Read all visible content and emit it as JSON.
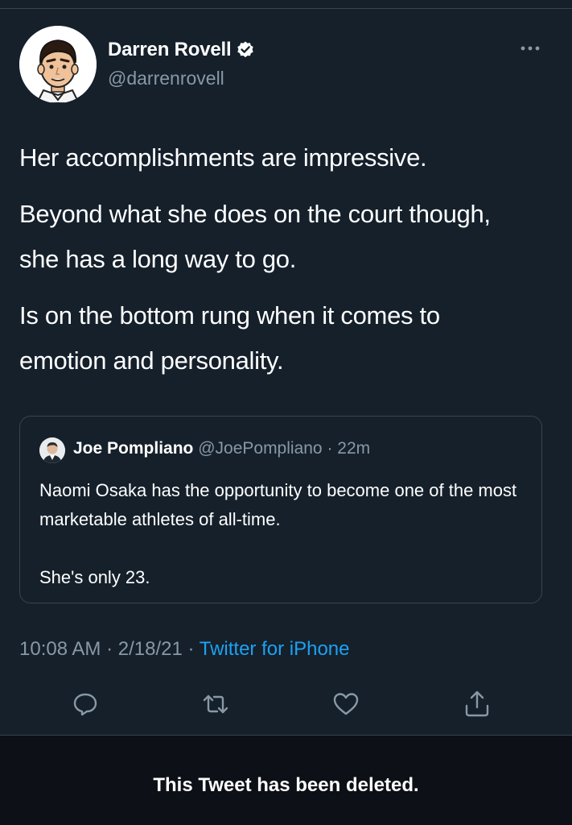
{
  "author": {
    "display_name": "Darren Rovell",
    "handle": "@darrenrovell",
    "verified": true,
    "avatar_icon": "cartoon-man-avatar-icon"
  },
  "tweet": {
    "paragraphs": [
      "Her accomplishments are impressive.",
      "Beyond what she does on the court though, she has a long way to go.",
      "Is on the bottom rung when it comes to emotion and personality."
    ]
  },
  "quoted_tweet": {
    "display_name": "Joe Pompliano",
    "handle": "@JoePompliano",
    "separator": "·",
    "time": "22m",
    "body_line1": "Naomi Osaka has the opportunity to become one of the most marketable athletes of all-time.",
    "body_line2": "She's only 23."
  },
  "meta": {
    "time": "10:08 AM",
    "separator1": "·",
    "date": "2/18/21",
    "separator2": "·",
    "source": "Twitter for iPhone"
  },
  "actions": {
    "reply_icon": "reply-icon",
    "retweet_icon": "retweet-icon",
    "like_icon": "heart-icon",
    "share_icon": "share-icon"
  },
  "notice": {
    "deleted_text": "This Tweet has been deleted."
  },
  "colors": {
    "background": "#15202b",
    "secondary_text": "#8899a6",
    "accent": "#1da1f2",
    "border": "#38444d"
  }
}
